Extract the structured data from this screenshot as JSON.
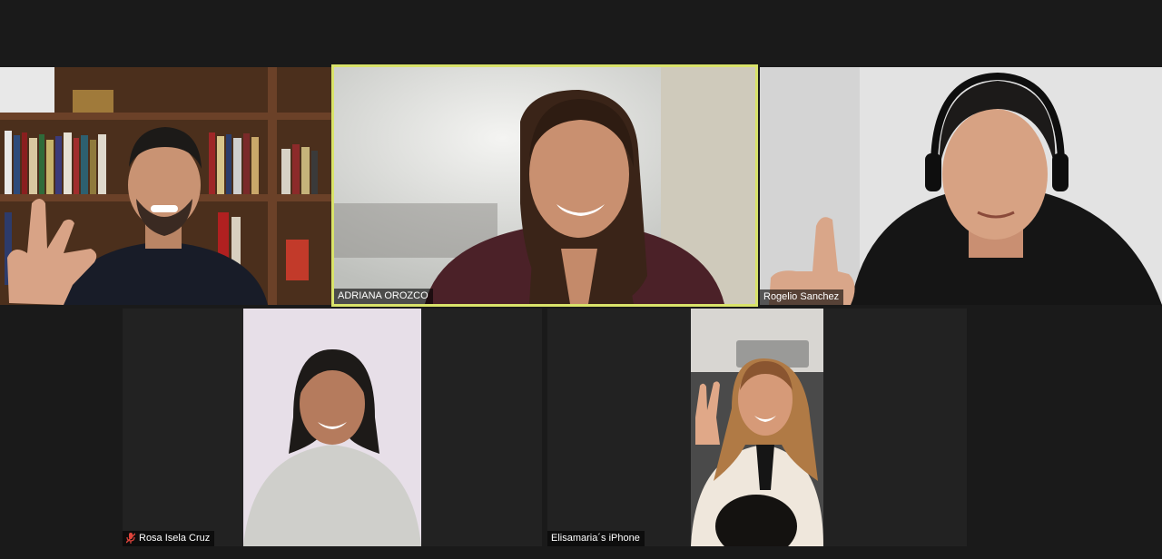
{
  "participants": [
    {
      "name": "",
      "icon": "person-video",
      "colors": {
        "bg": "#5b3b25",
        "shirt": "#181c28",
        "skin": "#c99373"
      }
    },
    {
      "name": "ADRIANA OROZCO",
      "icon": "person-video",
      "active_speaker": true,
      "colors": {
        "bg": "#d9dbd8",
        "shirt": "#4b2128",
        "skin": "#c99070"
      }
    },
    {
      "name": "Rogelio Sanchez",
      "icon": "person-video",
      "colors": {
        "bg": "#e3e3e3",
        "shirt": "#151515",
        "skin": "#d7a283"
      }
    },
    {
      "name": "Rosa Isela Cruz",
      "icon": "person-video",
      "muted": true,
      "colors": {
        "bg": "#e7dfe8",
        "shirt": "#cfcfcb",
        "skin": "#b57b5d"
      }
    },
    {
      "name": "Elisamaria´s iPhone",
      "icon": "person-video",
      "colors": {
        "bg": "#4a4a4a",
        "shirt": "#efe7dc",
        "skin": "#d69a78"
      }
    }
  ],
  "colors": {
    "active_border": "#d9e36a",
    "muted_icon": "#e0453c",
    "stage_bg": "#1a1a1a"
  }
}
